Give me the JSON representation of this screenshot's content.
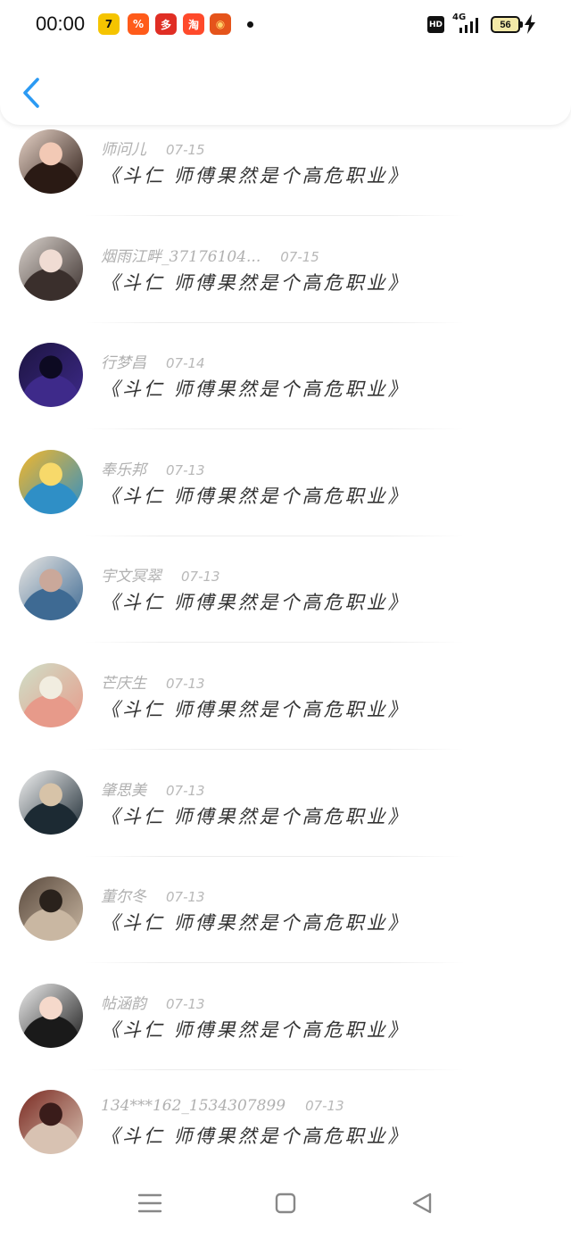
{
  "status_bar": {
    "time": "00:00",
    "app_icons": [
      {
        "name": "tiantian-icon",
        "glyph": "7",
        "bg": "#f5c400",
        "fg": "#111111"
      },
      {
        "name": "taobao-special-icon",
        "glyph": "%",
        "bg": "#ff5b1a",
        "fg": "#ffffff"
      },
      {
        "name": "pinduoduo-icon",
        "glyph": "多",
        "bg": "#e02e24",
        "fg": "#ffffff"
      },
      {
        "name": "shopping-app-icon",
        "glyph": "淘",
        "bg": "#ff4a2b",
        "fg": "#ffffff"
      },
      {
        "name": "pumpkin-icon",
        "glyph": "◉",
        "bg": "#e5541b",
        "fg": "#ffd36a"
      }
    ],
    "hd_label": "HD",
    "network_label": "4G",
    "battery_level": "56"
  },
  "header": {
    "back_icon": "chevron-left-icon",
    "accent_color": "#2b9af3"
  },
  "items": [
    {
      "name": "师问儿",
      "date": "07-15",
      "message": "《斗仁 师傅果然是个高危职业》"
    },
    {
      "name": "烟雨江畔_37176104...",
      "date": "07-15",
      "message": "《斗仁 师傅果然是个高危职业》"
    },
    {
      "name": "行梦昌",
      "date": "07-14",
      "message": "《斗仁 师傅果然是个高危职业》"
    },
    {
      "name": "奉乐邦",
      "date": "07-13",
      "message": "《斗仁 师傅果然是个高危职业》"
    },
    {
      "name": "宇文冥翠",
      "date": "07-13",
      "message": "《斗仁 师傅果然是个高危职业》"
    },
    {
      "name": "芒庆生",
      "date": "07-13",
      "message": "《斗仁 师傅果然是个高危职业》"
    },
    {
      "name": "肇思美",
      "date": "07-13",
      "message": "《斗仁 师傅果然是个高危职业》"
    },
    {
      "name": "董尔冬",
      "date": "07-13",
      "message": "《斗仁 师傅果然是个高危职业》"
    },
    {
      "name": "帖涵韵",
      "date": "07-13",
      "message": "《斗仁 师傅果然是个高危职业》"
    },
    {
      "name": "134***162_1534307899",
      "date": "07-13",
      "message": "《斗仁 师傅果然是个高危职业》"
    }
  ],
  "avatars": [
    {
      "colors": [
        "#e8d4c8",
        "#2a1a14",
        "#f2c9b5"
      ]
    },
    {
      "colors": [
        "#d9d2cc",
        "#3a2f2c",
        "#f0dcd3"
      ]
    },
    {
      "colors": [
        "#1c1440",
        "#3e2a8a",
        "#0d0a22"
      ]
    },
    {
      "colors": [
        "#f4b72a",
        "#2f8fc6",
        "#f7d96a"
      ]
    },
    {
      "colors": [
        "#e8e6e3",
        "#3e6a93",
        "#caa89a"
      ]
    },
    {
      "colors": [
        "#cfe0c8",
        "#e79a8a",
        "#f1ede0"
      ]
    },
    {
      "colors": [
        "#f2f2f2",
        "#1c2a33",
        "#d7c3a8"
      ]
    },
    {
      "colors": [
        "#5a4a3e",
        "#c9b7a2",
        "#2a221c"
      ]
    },
    {
      "colors": [
        "#eeeeee",
        "#1a1a1a",
        "#f5d9cb"
      ]
    },
    {
      "colors": [
        "#7a2a22",
        "#d8c2b2",
        "#3a1c1a"
      ]
    }
  ],
  "navigation": {
    "menu_icon": "menu-lines-icon",
    "home_icon": "square-home-icon",
    "back_icon": "triangle-back-icon"
  }
}
